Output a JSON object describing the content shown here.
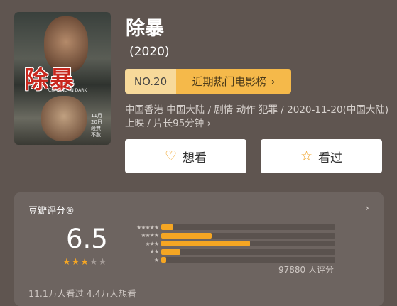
{
  "movie": {
    "title": "除暴",
    "year": "(2020)",
    "poster": {
      "title_text": "除暴",
      "subtitle": "CHASING IN DARK",
      "date_text": "11月20日 殺無不赦"
    },
    "rank": {
      "no": "NO.20",
      "label": "近期热门电影榜",
      "chevron": "›"
    },
    "meta": "中国香港 中国大陆 / 剧情 动作 犯罪 / 2020-11-20(中国大陆) 上映 / 片长95分钟 ›"
  },
  "actions": {
    "want": {
      "label": "想看",
      "icon": "heart-plus-icon",
      "glyph": "♡"
    },
    "seen": {
      "label": "看过",
      "icon": "star-outline-icon",
      "glyph": "☆"
    }
  },
  "rating": {
    "label": "豆瓣评分®",
    "chevron": "›",
    "score": "6.5",
    "stars_filled": 3,
    "stars_total": 5,
    "count_text": "97880 人评分",
    "distribution": [
      {
        "stars": "★★★★★",
        "fraction": 0.07
      },
      {
        "stars": "★★★★",
        "fraction": 0.29
      },
      {
        "stars": "★★★",
        "fraction": 0.51
      },
      {
        "stars": "★★",
        "fraction": 0.11
      },
      {
        "stars": "★",
        "fraction": 0.03
      }
    ],
    "footer": "11.1万人看过   4.4万人想看"
  },
  "colors": {
    "accent": "#f5a623",
    "background": "#5f5550",
    "card": "#6d6460"
  }
}
